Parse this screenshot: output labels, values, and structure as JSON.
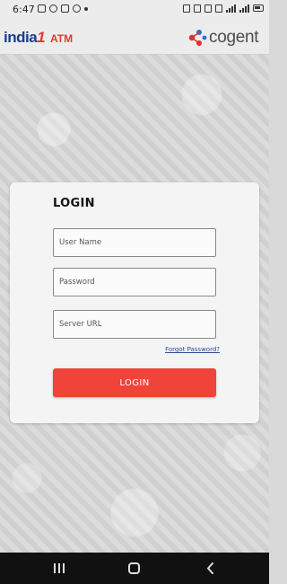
{
  "status_bar": {
    "time": "6:47",
    "network_label_1": "Vo))\nLTE1",
    "network_label_2": "Vo))\nLTE2"
  },
  "header": {
    "left_logo_text": "india",
    "left_logo_one": "1",
    "left_logo_atm": "ATM",
    "right_logo_text": "cogent",
    "brand_colors": {
      "india_blue": "#1b3f8c",
      "india_red": "#e23a2e",
      "cogent_red": "#e0312c",
      "cogent_blue": "#2c6fd1"
    }
  },
  "login": {
    "title": "LOGIN",
    "username_placeholder": "User Name",
    "username_value": "",
    "password_placeholder": "Password",
    "password_value": "",
    "server_placeholder": "Server URL",
    "server_value": "",
    "forgot_link": "Forgot Password?",
    "submit_label": "LOGIN",
    "accent_color": "#f0433a"
  },
  "nav": {
    "recent_icon": "recent-apps-icon",
    "home_icon": "home-icon",
    "back_icon": "back-icon"
  }
}
